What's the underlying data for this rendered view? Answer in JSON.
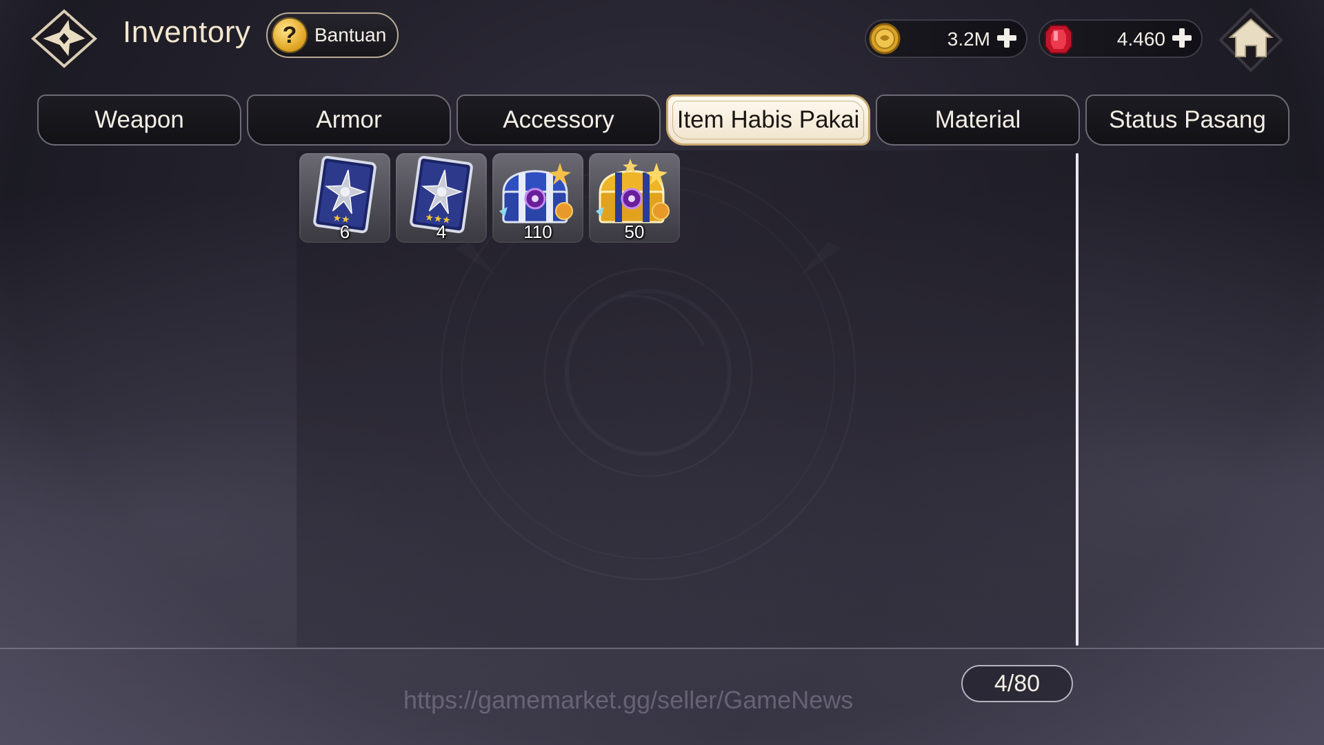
{
  "header": {
    "title": "Inventory",
    "help_label": "Bantuan"
  },
  "currencies": {
    "gold": {
      "value": "3.2M",
      "icon": "gold-coin-icon"
    },
    "gem": {
      "value": "4.460",
      "icon": "red-gem-icon"
    }
  },
  "tabs": [
    {
      "label": "Weapon",
      "active": false
    },
    {
      "label": "Armor",
      "active": false
    },
    {
      "label": "Accessory",
      "active": false
    },
    {
      "label": "Item Habis Pakai",
      "active": true
    },
    {
      "label": "Material",
      "active": false
    },
    {
      "label": "Status Pasang",
      "active": false
    }
  ],
  "items": [
    {
      "name": "card-2-star",
      "icon": "star-card-icon",
      "stars": 2,
      "count": "6"
    },
    {
      "name": "card-3-star",
      "icon": "star-card-icon",
      "stars": 3,
      "count": "4"
    },
    {
      "name": "blue-chest",
      "icon": "blue-treasure-chest-icon",
      "count": "110"
    },
    {
      "name": "gold-chest",
      "icon": "gold-treasure-chest-icon",
      "count": "50"
    }
  ],
  "capacity": "4/80",
  "watermark": "https://gamemarket.gg/seller/GameNews",
  "colors": {
    "active_tab_bg": "#f6eddc",
    "accent_gold": "#c9aa70",
    "background": "#24222d"
  }
}
